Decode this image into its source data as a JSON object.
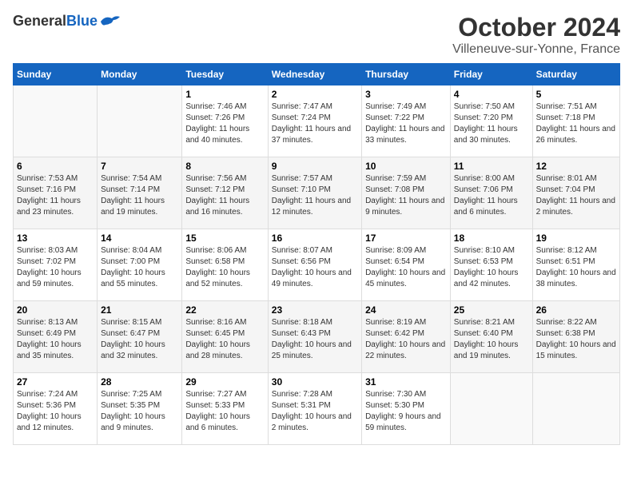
{
  "logo": {
    "general": "General",
    "blue": "Blue"
  },
  "title": "October 2024",
  "subtitle": "Villeneuve-sur-Yonne, France",
  "days_header": [
    "Sunday",
    "Monday",
    "Tuesday",
    "Wednesday",
    "Thursday",
    "Friday",
    "Saturday"
  ],
  "weeks": [
    [
      {
        "day": "",
        "sunrise": "",
        "sunset": "",
        "daylight": ""
      },
      {
        "day": "",
        "sunrise": "",
        "sunset": "",
        "daylight": ""
      },
      {
        "day": "1",
        "sunrise": "Sunrise: 7:46 AM",
        "sunset": "Sunset: 7:26 PM",
        "daylight": "Daylight: 11 hours and 40 minutes."
      },
      {
        "day": "2",
        "sunrise": "Sunrise: 7:47 AM",
        "sunset": "Sunset: 7:24 PM",
        "daylight": "Daylight: 11 hours and 37 minutes."
      },
      {
        "day": "3",
        "sunrise": "Sunrise: 7:49 AM",
        "sunset": "Sunset: 7:22 PM",
        "daylight": "Daylight: 11 hours and 33 minutes."
      },
      {
        "day": "4",
        "sunrise": "Sunrise: 7:50 AM",
        "sunset": "Sunset: 7:20 PM",
        "daylight": "Daylight: 11 hours and 30 minutes."
      },
      {
        "day": "5",
        "sunrise": "Sunrise: 7:51 AM",
        "sunset": "Sunset: 7:18 PM",
        "daylight": "Daylight: 11 hours and 26 minutes."
      }
    ],
    [
      {
        "day": "6",
        "sunrise": "Sunrise: 7:53 AM",
        "sunset": "Sunset: 7:16 PM",
        "daylight": "Daylight: 11 hours and 23 minutes."
      },
      {
        "day": "7",
        "sunrise": "Sunrise: 7:54 AM",
        "sunset": "Sunset: 7:14 PM",
        "daylight": "Daylight: 11 hours and 19 minutes."
      },
      {
        "day": "8",
        "sunrise": "Sunrise: 7:56 AM",
        "sunset": "Sunset: 7:12 PM",
        "daylight": "Daylight: 11 hours and 16 minutes."
      },
      {
        "day": "9",
        "sunrise": "Sunrise: 7:57 AM",
        "sunset": "Sunset: 7:10 PM",
        "daylight": "Daylight: 11 hours and 12 minutes."
      },
      {
        "day": "10",
        "sunrise": "Sunrise: 7:59 AM",
        "sunset": "Sunset: 7:08 PM",
        "daylight": "Daylight: 11 hours and 9 minutes."
      },
      {
        "day": "11",
        "sunrise": "Sunrise: 8:00 AM",
        "sunset": "Sunset: 7:06 PM",
        "daylight": "Daylight: 11 hours and 6 minutes."
      },
      {
        "day": "12",
        "sunrise": "Sunrise: 8:01 AM",
        "sunset": "Sunset: 7:04 PM",
        "daylight": "Daylight: 11 hours and 2 minutes."
      }
    ],
    [
      {
        "day": "13",
        "sunrise": "Sunrise: 8:03 AM",
        "sunset": "Sunset: 7:02 PM",
        "daylight": "Daylight: 10 hours and 59 minutes."
      },
      {
        "day": "14",
        "sunrise": "Sunrise: 8:04 AM",
        "sunset": "Sunset: 7:00 PM",
        "daylight": "Daylight: 10 hours and 55 minutes."
      },
      {
        "day": "15",
        "sunrise": "Sunrise: 8:06 AM",
        "sunset": "Sunset: 6:58 PM",
        "daylight": "Daylight: 10 hours and 52 minutes."
      },
      {
        "day": "16",
        "sunrise": "Sunrise: 8:07 AM",
        "sunset": "Sunset: 6:56 PM",
        "daylight": "Daylight: 10 hours and 49 minutes."
      },
      {
        "day": "17",
        "sunrise": "Sunrise: 8:09 AM",
        "sunset": "Sunset: 6:54 PM",
        "daylight": "Daylight: 10 hours and 45 minutes."
      },
      {
        "day": "18",
        "sunrise": "Sunrise: 8:10 AM",
        "sunset": "Sunset: 6:53 PM",
        "daylight": "Daylight: 10 hours and 42 minutes."
      },
      {
        "day": "19",
        "sunrise": "Sunrise: 8:12 AM",
        "sunset": "Sunset: 6:51 PM",
        "daylight": "Daylight: 10 hours and 38 minutes."
      }
    ],
    [
      {
        "day": "20",
        "sunrise": "Sunrise: 8:13 AM",
        "sunset": "Sunset: 6:49 PM",
        "daylight": "Daylight: 10 hours and 35 minutes."
      },
      {
        "day": "21",
        "sunrise": "Sunrise: 8:15 AM",
        "sunset": "Sunset: 6:47 PM",
        "daylight": "Daylight: 10 hours and 32 minutes."
      },
      {
        "day": "22",
        "sunrise": "Sunrise: 8:16 AM",
        "sunset": "Sunset: 6:45 PM",
        "daylight": "Daylight: 10 hours and 28 minutes."
      },
      {
        "day": "23",
        "sunrise": "Sunrise: 8:18 AM",
        "sunset": "Sunset: 6:43 PM",
        "daylight": "Daylight: 10 hours and 25 minutes."
      },
      {
        "day": "24",
        "sunrise": "Sunrise: 8:19 AM",
        "sunset": "Sunset: 6:42 PM",
        "daylight": "Daylight: 10 hours and 22 minutes."
      },
      {
        "day": "25",
        "sunrise": "Sunrise: 8:21 AM",
        "sunset": "Sunset: 6:40 PM",
        "daylight": "Daylight: 10 hours and 19 minutes."
      },
      {
        "day": "26",
        "sunrise": "Sunrise: 8:22 AM",
        "sunset": "Sunset: 6:38 PM",
        "daylight": "Daylight: 10 hours and 15 minutes."
      }
    ],
    [
      {
        "day": "27",
        "sunrise": "Sunrise: 7:24 AM",
        "sunset": "Sunset: 5:36 PM",
        "daylight": "Daylight: 10 hours and 12 minutes."
      },
      {
        "day": "28",
        "sunrise": "Sunrise: 7:25 AM",
        "sunset": "Sunset: 5:35 PM",
        "daylight": "Daylight: 10 hours and 9 minutes."
      },
      {
        "day": "29",
        "sunrise": "Sunrise: 7:27 AM",
        "sunset": "Sunset: 5:33 PM",
        "daylight": "Daylight: 10 hours and 6 minutes."
      },
      {
        "day": "30",
        "sunrise": "Sunrise: 7:28 AM",
        "sunset": "Sunset: 5:31 PM",
        "daylight": "Daylight: 10 hours and 2 minutes."
      },
      {
        "day": "31",
        "sunrise": "Sunrise: 7:30 AM",
        "sunset": "Sunset: 5:30 PM",
        "daylight": "Daylight: 9 hours and 59 minutes."
      },
      {
        "day": "",
        "sunrise": "",
        "sunset": "",
        "daylight": ""
      },
      {
        "day": "",
        "sunrise": "",
        "sunset": "",
        "daylight": ""
      }
    ]
  ]
}
